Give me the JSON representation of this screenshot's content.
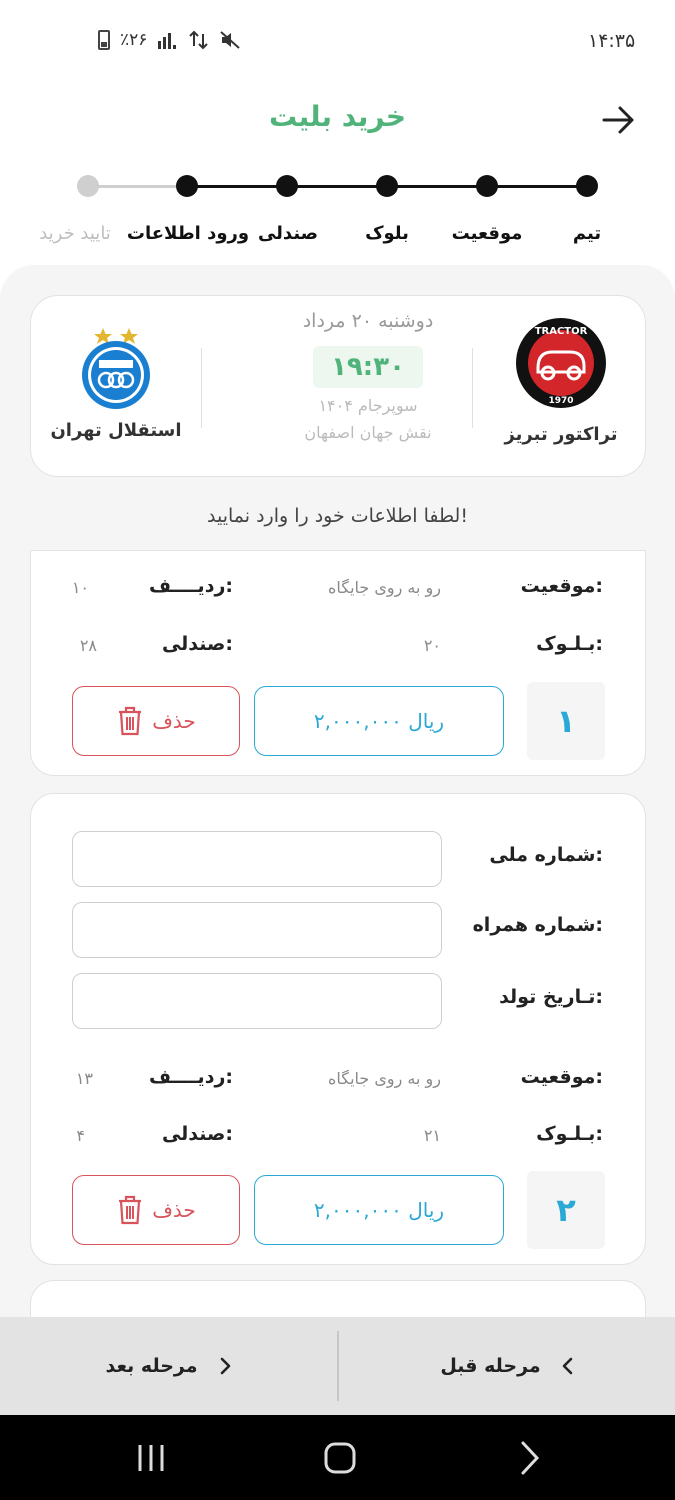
{
  "status_bar": {
    "time": "۱۴:۳۵",
    "battery": "٪۲۶"
  },
  "header": {
    "title": "خرید بلیت"
  },
  "stepper": {
    "steps": [
      {
        "label": "تیم",
        "done": true
      },
      {
        "label": "موقعیت",
        "done": true
      },
      {
        "label": "بلوک",
        "done": true
      },
      {
        "label": "صندلی",
        "done": true
      },
      {
        "label": "ورود اطلاعات",
        "done": true
      },
      {
        "label": "تایید خرید",
        "done": false
      }
    ]
  },
  "match": {
    "home_team": "تراکتور تبریز",
    "home_logo_text": "TRACTOR",
    "home_logo_year": "1970",
    "away_team": "استقلال تهران",
    "date": "دوشنبه ۲۰ مرداد",
    "time": "۱۹:۳۰",
    "league": "سوپرجام ۱۴۰۴",
    "stadium": "نقش جهان اصفهان",
    "colors": {
      "tractor": "#d3262b",
      "esteghlal": "#1a7fd0",
      "star": "#e2b62f"
    }
  },
  "instruction": "لطفا اطلاعات خود را وارد نمایید!",
  "labels": {
    "position": "موقعیت:",
    "row": "ردیــــف:",
    "block": "بـلـوک:",
    "seat": "صندلی:",
    "national_id": "شماره ملی:",
    "mobile": "شماره همراه:",
    "birth_date": "تـاریخ تولد:",
    "delete": "حذف"
  },
  "tickets": [
    {
      "number": "۱",
      "position": "رو به روی جایگاه",
      "row": "۱۰",
      "block": "۲۰",
      "seat": "۲۸",
      "price": "۲,۰۰۰,۰۰۰ ریال"
    },
    {
      "number": "۲",
      "position": "رو به روی جایگاه",
      "row": "۱۳",
      "block": "۲۱",
      "seat": "۴",
      "price": "۲,۰۰۰,۰۰۰ ریال",
      "inputs": {
        "national_id": "",
        "mobile": "",
        "birth_date": ""
      }
    }
  ],
  "footer": {
    "prev_label": "مرحله قبل",
    "next_label": "مرحله بعد"
  },
  "theme": {
    "accent": "#4fb37a",
    "price": "#2aa8d6",
    "danger": "#d9535b"
  }
}
